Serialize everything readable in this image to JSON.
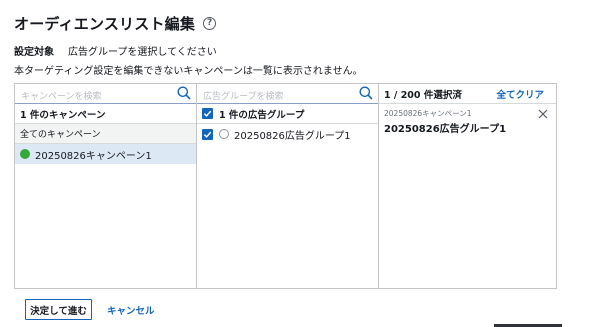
{
  "header": {
    "title": "オーディエンスリスト編集",
    "help_icon_text": "?"
  },
  "target": {
    "label": "設定対象",
    "value": "広告グループを選択してください"
  },
  "note": "本ターゲティング設定を編集できないキャンペーンは一覧に表示されません。",
  "campaign_panel": {
    "search_placeholder": "キャンペーンを検索",
    "count_label": "1 件のキャンペーン",
    "all_label": "全てのキャンペーン",
    "items": [
      {
        "label": "20250826キャンペーン1",
        "status_color": "#35a83a"
      }
    ]
  },
  "adgroup_panel": {
    "search_placeholder": "広告グループを検索",
    "count_label": "1 件の広告グループ",
    "items": [
      {
        "label": "20250826広告グループ1",
        "checked": true
      }
    ]
  },
  "selected_panel": {
    "count_label": "1 / 200 件選択済",
    "clear_label": "全てクリア",
    "items": [
      {
        "campaign": "20250826キャンペーン1",
        "adgroup": "20250826広告グループ1"
      }
    ]
  },
  "footer": {
    "confirm_label": "決定して進む",
    "cancel_label": "キャンセル"
  },
  "colors": {
    "accent": "#1166bb",
    "selected_row": "#dde8f5",
    "status_active": "#35a83a"
  }
}
